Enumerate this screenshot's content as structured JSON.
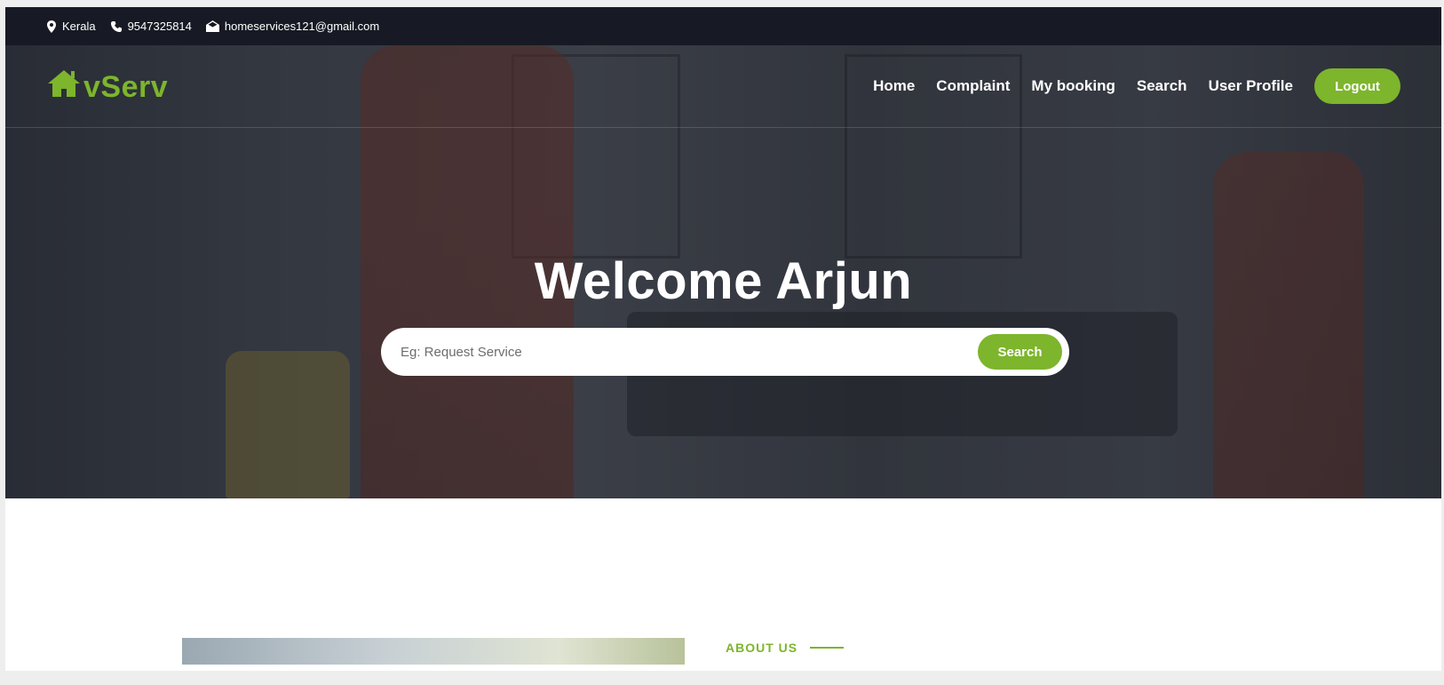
{
  "topbar": {
    "location": "Kerala",
    "phone": "9547325814",
    "email": "homeservices121@gmail.com"
  },
  "brand": {
    "name": "vServ",
    "color": "#7db52c"
  },
  "nav": {
    "items": [
      "Home",
      "Complaint",
      "My booking",
      "Search",
      "User Profile"
    ],
    "logout_label": "Logout"
  },
  "hero": {
    "title": "Welcome Arjun",
    "search_placeholder": "Eg: Request Service",
    "search_button": "Search"
  },
  "about": {
    "label": "ABOUT US"
  },
  "icons": {
    "location": "map-pin-icon",
    "phone": "phone-icon",
    "email": "envelope-icon",
    "logo": "house-icon"
  }
}
